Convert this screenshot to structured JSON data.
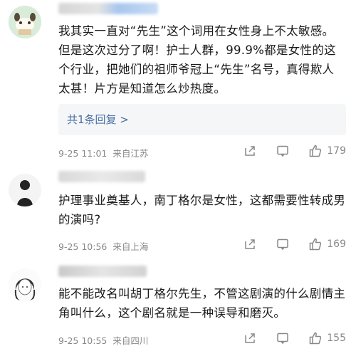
{
  "comments": [
    {
      "text": "我其实一直对“先生”这个词用在女性身上不太敏感。但是这次过分了啊！护士人群，99.9%都是女性的这个行业，把她们的祖师爷冠上“先生”名号，真得欺人太甚！片方是知道怎么炒热度。",
      "replies_label": "共1条回复 >",
      "time": "9-25 11:01",
      "location": "来自江苏",
      "likes": "179"
    },
    {
      "text": "护理事业奠基人，南丁格尔是女性，这都需要性转成男的演吗?",
      "time": "9-25 10:56",
      "location": "来自上海",
      "likes": "169"
    },
    {
      "text": "能不能改名叫胡丁格尔先生，不管这剧演的什么剧情主角叫什么，这个剧名就是一种误导和磨灭。",
      "time": "9-25 10:55",
      "location": "来自四川",
      "likes": "155"
    }
  ],
  "icons": {
    "share": "share-icon",
    "comment": "comment-icon",
    "like": "thumbs-up-icon"
  }
}
